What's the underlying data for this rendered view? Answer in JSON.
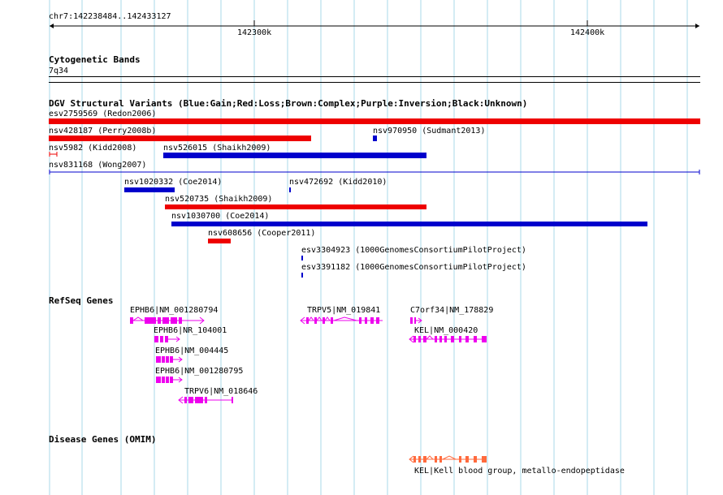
{
  "colors": {
    "grid": "#a8d8ea",
    "gain": "#0000cc",
    "loss": "#ee0000",
    "gene": "#ee00ee",
    "omim": "#ff6a3d",
    "axis": "#000000"
  },
  "ruler": {
    "location": "chr7:142238484..142433127",
    "ticks": [
      "142300k",
      "142400k"
    ]
  },
  "tracks": {
    "cytoband": {
      "title": "Cytogenetic Bands",
      "band": "7q34"
    },
    "dgv": {
      "title": "DGV Structural Variants (Blue:Gain;Red:Loss;Brown:Complex;Purple:Inversion;Black:Unknown)",
      "variants": [
        {
          "label": "esv2759569 (Redon2006)",
          "type": "loss"
        },
        {
          "label": "nsv428187 (Perry2008b)",
          "type": "loss"
        },
        {
          "label": "nsv970950 (Sudmant2013)",
          "type": "gain"
        },
        {
          "label": "nsv5982 (Kidd2008)",
          "type": "loss"
        },
        {
          "label": "nsv526015 (Shaikh2009)",
          "type": "gain"
        },
        {
          "label": "nsv831168 (Wong2007)",
          "type": "gain"
        },
        {
          "label": "nsv1020332 (Coe2014)",
          "type": "gain"
        },
        {
          "label": "nsv472692 (Kidd2010)",
          "type": "gain"
        },
        {
          "label": "nsv520735 (Shaikh2009)",
          "type": "loss"
        },
        {
          "label": "nsv1030700 (Coe2014)",
          "type": "gain"
        },
        {
          "label": "nsv608656 (Cooper2011)",
          "type": "loss"
        },
        {
          "label": "esv3304923 (1000GenomesConsortiumPilotProject)",
          "type": "gain"
        },
        {
          "label": "esv3391182 (1000GenomesConsortiumPilotProject)",
          "type": "gain"
        }
      ]
    },
    "refseq": {
      "title": "RefSeq Genes",
      "genes": [
        {
          "label": "EPHB6|NM_001280794"
        },
        {
          "label": "TRPV5|NM_019841"
        },
        {
          "label": "C7orf34|NM_178829"
        },
        {
          "label": "EPHB6|NR_104001"
        },
        {
          "label": "KEL|NM_000420"
        },
        {
          "label": "EPHB6|NM_004445"
        },
        {
          "label": "EPHB6|NM_001280795"
        },
        {
          "label": "TRPV6|NM_018646"
        }
      ]
    },
    "omim": {
      "title": "Disease Genes (OMIM)",
      "genes": [
        {
          "label": "KEL|Kell blood group, metallo-endopeptidase"
        }
      ]
    }
  }
}
